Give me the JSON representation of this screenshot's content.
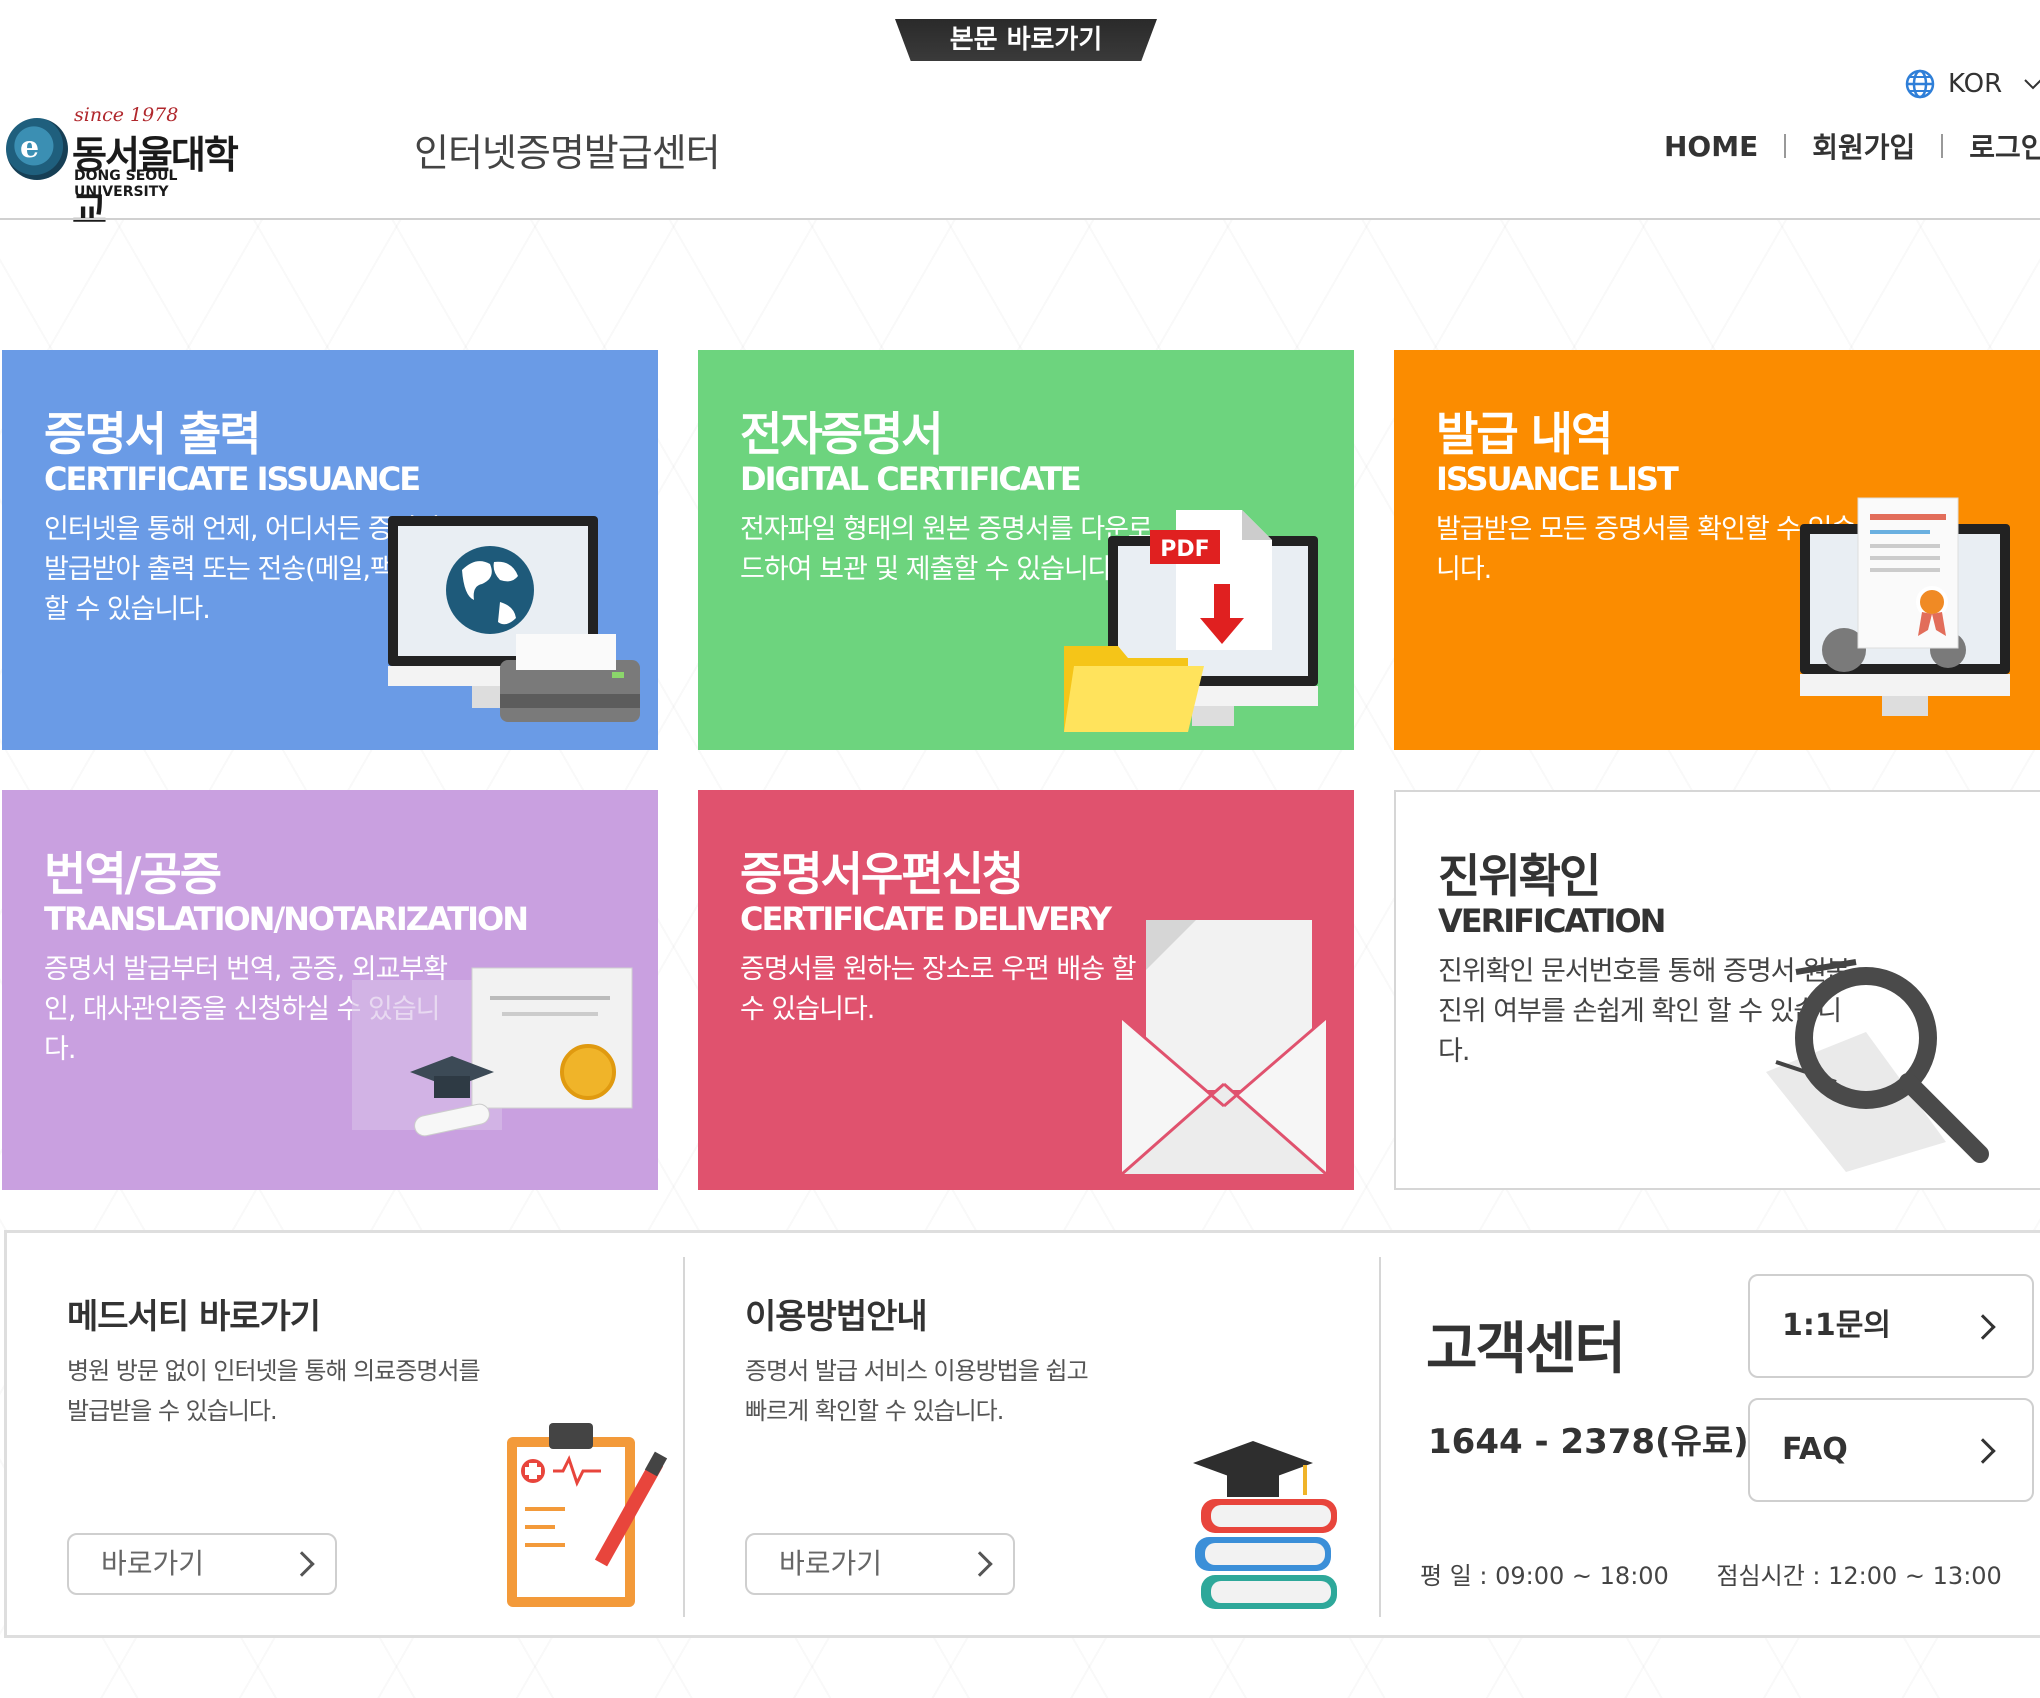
{
  "skip_link": "본문 바로가기",
  "header": {
    "logo": {
      "since": "since 1978",
      "korean_name": "동서울대학교",
      "english_name": "DONG SEOUL UNIVERSITY",
      "emblem_letter": "e"
    },
    "site_title": "인터넷증명발급센터",
    "language": {
      "icon": "globe-icon",
      "label": "KOR"
    },
    "nav": {
      "home": "HOME",
      "signup": "회원가입",
      "login": "로그인"
    }
  },
  "tiles": [
    {
      "ko": "증명서 출력",
      "en": "CERTIFICATE ISSUANCE",
      "desc": "인터넷을 통해 언제, 어디서든 증명서를 발급받아 출력 또는 전송(메일,팩스)을 할 수 있습니다.",
      "color": "#6a9be6",
      "icon": "monitor-globe-printer-icon"
    },
    {
      "ko": "전자증명서",
      "en": "DIGITAL CERTIFICATE",
      "desc": "전자파일 형태의 원본 증명서를 다운로드하여 보관 및 제출할 수 있습니다.",
      "color": "#6dd47e",
      "icon": "pdf-download-icon",
      "pdf_label": "PDF"
    },
    {
      "ko": "발급 내역",
      "en": "ISSUANCE LIST",
      "desc": "발급받은 모든 증명서를 확인할 수 있습니다.",
      "color": "#fb8c00",
      "icon": "certificate-monitor-icon"
    },
    {
      "ko": "번역/공증",
      "en": "TRANSLATION/NOTARIZATION",
      "desc": "증명서 발급부터 번역, 공증, 외교부확인, 대사관인증을 신청하실 수 있습니다.",
      "color": "#c9a0e0",
      "icon": "diploma-graduation-icon"
    },
    {
      "ko": "증명서우편신청",
      "en": "CERTIFICATE DELIVERY",
      "desc": "증명서를 원하는 장소로 우편 배송 할 수 있습니다.",
      "color": "#e0526e",
      "icon": "envelope-icon"
    },
    {
      "ko": "진위확인",
      "en": "VERIFICATION",
      "desc": "진위확인 문서번호를 통해 증명서 원본 진위 여부를 손쉽게 확인 할 수 있습니다.",
      "color": "#ffffff",
      "icon": "magnifier-icon"
    }
  ],
  "bottom": {
    "medcerti": {
      "title": "메드서티 바로가기",
      "desc": "병원 방문 없이 인터넷을 통해 의료증명서를 발급받을 수 있습니다.",
      "button": "바로가기",
      "icon": "medical-clipboard-icon"
    },
    "guide": {
      "title": "이용방법안내",
      "desc": "증명서 발급 서비스 이용방법을 쉽고 빠르게 확인할 수 있습니다.",
      "button": "바로가기",
      "icon": "books-graduation-icon"
    },
    "support": {
      "title": "고객센터",
      "phone": "1644 - 2378(유료)",
      "hours_weekday_label": "평 일 : 09:00 ~ 18:00",
      "hours_lunch_label": "점심시간 : 12:00 ~ 13:00",
      "inquiry_button": "1:1문의",
      "faq_button": "FAQ"
    }
  }
}
